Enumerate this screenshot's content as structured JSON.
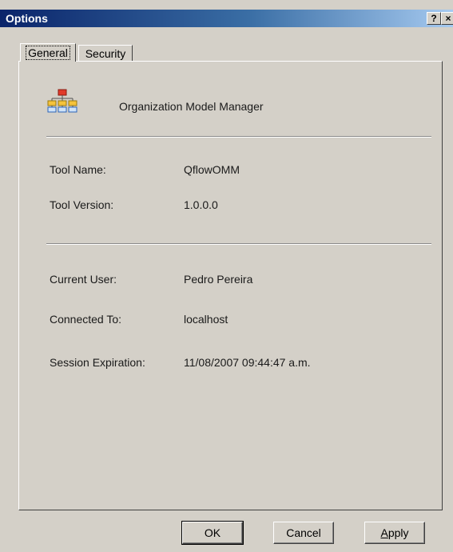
{
  "window": {
    "title": "Options",
    "help_label": "?",
    "close_label": "×"
  },
  "tabs": [
    {
      "label": "General"
    },
    {
      "label": "Security"
    }
  ],
  "app": {
    "name": "Organization Model Manager",
    "icon": "org-chart-icon"
  },
  "fields": [
    {
      "label": "Tool Name:",
      "value": "QflowOMM"
    },
    {
      "label": "Tool Version:",
      "value": "1.0.0.0"
    },
    {
      "label": "Current User:",
      "value": "Pedro Pereira"
    },
    {
      "label": "Connected To:",
      "value": "localhost"
    },
    {
      "label": "Session Expiration:",
      "value": "11/08/2007 09:44:47 a.m."
    }
  ],
  "buttons": {
    "ok": "OK",
    "cancel": "Cancel",
    "apply_first": "A",
    "apply_rest": "pply"
  }
}
